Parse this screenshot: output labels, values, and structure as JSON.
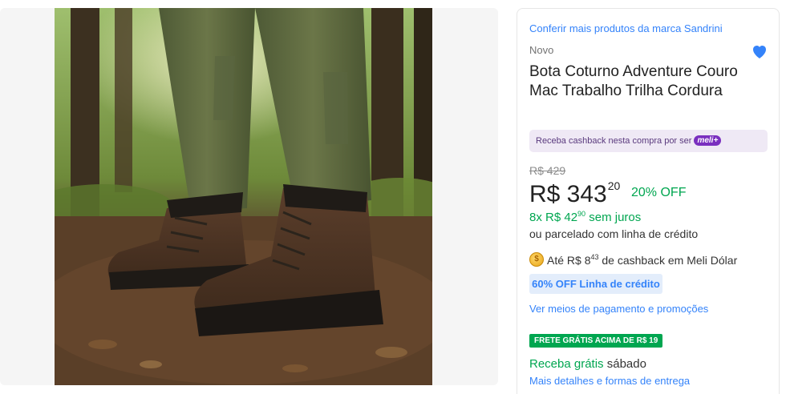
{
  "gallery": {
    "image_alt": "Bota Coturno Adventure Couro Mac Trabalho Trilha Cordura"
  },
  "product": {
    "brand_link": "Conferir mais produtos da marca Sandrini",
    "condition": "Novo",
    "title": "Bota Coturno Adventure Couro Mac Trabalho Trilha Cordura",
    "favorite_icon": "heart-icon"
  },
  "cashback_banner": {
    "text": "Receba cashback nesta compra por ser",
    "badge": "meli+"
  },
  "pricing": {
    "old_price": "R$ 429",
    "price_main": "R$ 343",
    "price_cents": "20",
    "discount": "20% OFF",
    "installments_prefix": "8x R$ 42",
    "installments_cents": "90",
    "installments_suffix": "sem juros",
    "credit_line": "ou parcelado com linha de crédito"
  },
  "meli_dolar": {
    "prefix": "Até R$ 8",
    "cents": "43",
    "suffix": "de cashback em Meli Dólar"
  },
  "credit_promo": "60% OFF Linha de crédito",
  "payment_link": "Ver meios de pagamento e promoções",
  "shipping": {
    "free_badge": "FRETE GRÁTIS ACIMA DE R$ 19",
    "receive_label": "Receba grátis",
    "day": "sábado",
    "details_link": "Mais detalhes e formas de entrega"
  },
  "colors": {
    "accent_blue": "#3483fa",
    "green": "#00a650",
    "meli_purple": "#7a2fbf"
  }
}
